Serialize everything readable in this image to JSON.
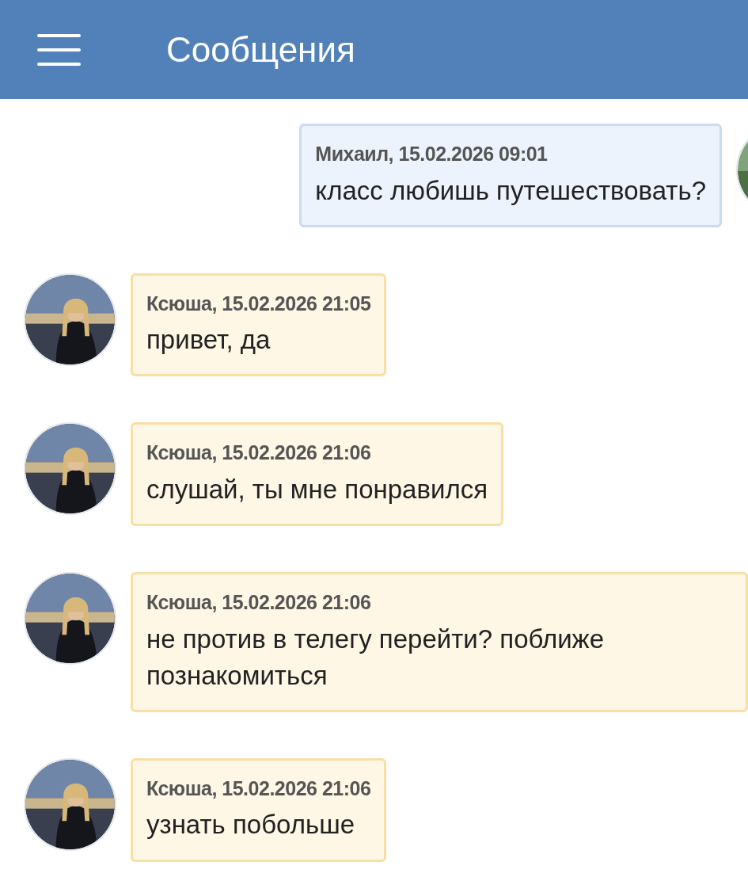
{
  "header": {
    "title": "Сообщения"
  },
  "messages": [
    {
      "kind": "outgoing",
      "meta": "Михаил, 15.02.2026 09:01",
      "text": "класс любишь путешествовать?"
    },
    {
      "kind": "incoming",
      "meta": "Ксюша, 15.02.2026 21:05",
      "text": "привет, да"
    },
    {
      "kind": "incoming",
      "meta": "Ксюша, 15.02.2026 21:06",
      "text": "слушай, ты мне понравился"
    },
    {
      "kind": "incoming",
      "meta": "Ксюша, 15.02.2026 21:06",
      "text": "не против в телегу перейти? поближе познакомиться"
    },
    {
      "kind": "incoming",
      "meta": "Ксюша, 15.02.2026 21:06",
      "text": "узнать побольше"
    }
  ]
}
